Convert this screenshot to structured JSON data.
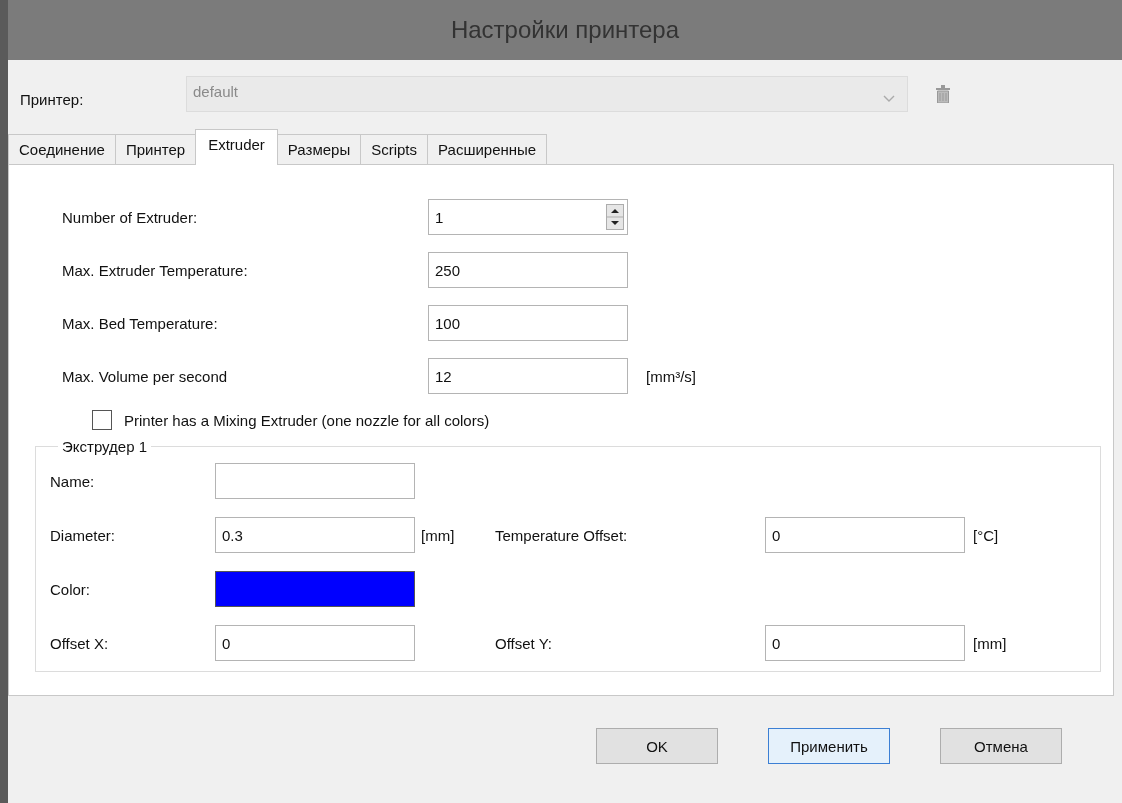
{
  "window": {
    "title": "Настройки принтера"
  },
  "printer": {
    "label": "Принтер:",
    "value": "default",
    "disabled": true
  },
  "tabs": [
    {
      "label": "Соединение",
      "selected": false
    },
    {
      "label": "Принтер",
      "selected": false
    },
    {
      "label": "Extruder",
      "selected": true
    },
    {
      "label": "Размеры",
      "selected": false
    },
    {
      "label": "Scripts",
      "selected": false
    },
    {
      "label": "Расширенные",
      "selected": false
    }
  ],
  "settings": [
    {
      "kind": "spin",
      "label": "Number of Extruder:",
      "value": "1"
    },
    {
      "kind": "text",
      "label": "Max. Extruder Temperature:",
      "value": "250"
    },
    {
      "kind": "text",
      "label": "Max. Bed Temperature:",
      "value": "100"
    },
    {
      "kind": "text",
      "label": "Max. Volume per second",
      "value": "12",
      "unit": "[mm³/s]"
    }
  ],
  "mixing_extruder": {
    "label": "Printer has a Mixing Extruder (one nozzle for all colors)",
    "checked": false
  },
  "extruder_group": {
    "title": "Экструдер 1",
    "name": {
      "label": "Name:"
    },
    "diameter": {
      "label": "Diameter:",
      "value": "0.3",
      "unit": "[mm]"
    },
    "temperature_offset": {
      "label": "Temperature Offset:",
      "value": "0",
      "unit": "[°C]"
    },
    "color": {
      "label": "Color:",
      "color": "#0000ff"
    },
    "offset_x": {
      "label": "Offset X:",
      "value": "0"
    },
    "offset_y": {
      "label": "Offset Y:",
      "value": "0",
      "unit": "[mm]"
    }
  },
  "buttons": [
    {
      "label": "OK",
      "focused": false
    },
    {
      "label": "Применить",
      "focused": true
    },
    {
      "label": "Отмена",
      "focused": false
    }
  ]
}
